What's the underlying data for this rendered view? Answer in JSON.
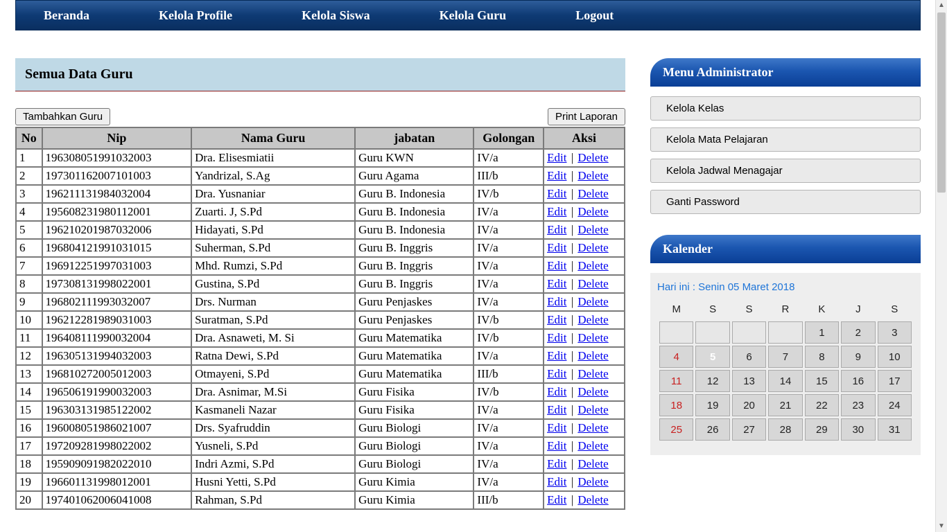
{
  "nav": {
    "items": [
      "Beranda",
      "Kelola Profile",
      "Kelola Siswa",
      "Kelola Guru",
      "Logout"
    ]
  },
  "page": {
    "title": "Semua Data Guru",
    "add_btn": "Tambahkan Guru",
    "print_btn": "Print Laporan",
    "edit_label": "Edit",
    "delete_label": "Delete",
    "separator": "|"
  },
  "table": {
    "headers": [
      "No",
      "Nip",
      "Nama Guru",
      "jabatan",
      "Golongan",
      "Aksi"
    ],
    "rows": [
      {
        "no": "1",
        "nip": "196308051991032003",
        "nama": "Dra. Elisesmiatii",
        "jabatan": "Guru KWN",
        "gol": "IV/a"
      },
      {
        "no": "2",
        "nip": "197301162007101003",
        "nama": "Yandrizal, S.Ag",
        "jabatan": "Guru Agama",
        "gol": "III/b"
      },
      {
        "no": "3",
        "nip": "196211131984032004",
        "nama": "Dra. Yusnaniar",
        "jabatan": "Guru B. Indonesia",
        "gol": "IV/b"
      },
      {
        "no": "4",
        "nip": "195608231980112001",
        "nama": "Zuarti. J, S.Pd",
        "jabatan": "Guru B. Indonesia",
        "gol": "IV/a"
      },
      {
        "no": "5",
        "nip": "196210201987032006",
        "nama": "Hidayati, S.Pd",
        "jabatan": "Guru B. Indonesia",
        "gol": "IV/a"
      },
      {
        "no": "6",
        "nip": "196804121991031015",
        "nama": "Suherman, S.Pd",
        "jabatan": "Guru B. Inggris",
        "gol": "IV/a"
      },
      {
        "no": "7",
        "nip": "196912251997031003",
        "nama": "Mhd. Rumzi, S.Pd",
        "jabatan": "Guru B. Inggris",
        "gol": "IV/a"
      },
      {
        "no": "8",
        "nip": "197308131998022001",
        "nama": "Gustina, S.Pd",
        "jabatan": "Guru B. Inggris",
        "gol": "IV/a"
      },
      {
        "no": "9",
        "nip": "196802111993032007",
        "nama": "Drs. Nurman",
        "jabatan": "Guru Penjaskes",
        "gol": "IV/a"
      },
      {
        "no": "10",
        "nip": "196212281989031003",
        "nama": "Suratman, S.Pd",
        "jabatan": "Guru Penjaskes",
        "gol": "IV/b"
      },
      {
        "no": "11",
        "nip": "196408111990032004",
        "nama": "Dra. Asnaweti, M. Si",
        "jabatan": "Guru Matematika",
        "gol": "IV/b"
      },
      {
        "no": "12",
        "nip": "196305131994032003",
        "nama": "Ratna Dewi, S.Pd",
        "jabatan": "Guru Matematika",
        "gol": "IV/a"
      },
      {
        "no": "13",
        "nip": "196810272005012003",
        "nama": "Otmayeni, S.Pd",
        "jabatan": "Guru Matematika",
        "gol": "III/b"
      },
      {
        "no": "14",
        "nip": "196506191990032003",
        "nama": "Dra. Asnimar, M.Si",
        "jabatan": "Guru Fisika",
        "gol": "IV/b"
      },
      {
        "no": "15",
        "nip": "196303131985122002",
        "nama": "Kasmaneli Nazar",
        "jabatan": "Guru Fisika",
        "gol": "IV/a"
      },
      {
        "no": "16",
        "nip": "196008051986021007",
        "nama": "Drs. Syafruddin",
        "jabatan": "Guru Biologi",
        "gol": "IV/a"
      },
      {
        "no": "17",
        "nip": "197209281998022002",
        "nama": "Yusneli, S.Pd",
        "jabatan": "Guru Biologi",
        "gol": "IV/a"
      },
      {
        "no": "18",
        "nip": "195909091982022010",
        "nama": "Indri Azmi, S.Pd",
        "jabatan": "Guru Biologi",
        "gol": "IV/a"
      },
      {
        "no": "19",
        "nip": "196601131998012001",
        "nama": "Husni Yetti, S.Pd",
        "jabatan": "Guru Kimia",
        "gol": "IV/a"
      },
      {
        "no": "20",
        "nip": "197401062006041008",
        "nama": "Rahman, S.Pd",
        "jabatan": "Guru Kimia",
        "gol": "III/b"
      }
    ]
  },
  "sidebar": {
    "menu_title": "Menu Administrator",
    "menu_items": [
      "Kelola Kelas",
      "Kelola Mata Pelajaran",
      "Kelola Jadwal Menagajar",
      "Ganti Password"
    ],
    "cal_title": "Kalender"
  },
  "calendar": {
    "today_label": "Hari ini : Senin 05 Maret 2018",
    "dow": [
      "M",
      "S",
      "S",
      "R",
      "K",
      "J",
      "S"
    ],
    "first_weekday_index": 4,
    "days_in_month": 31,
    "today": 5,
    "sunday_col": 0
  }
}
